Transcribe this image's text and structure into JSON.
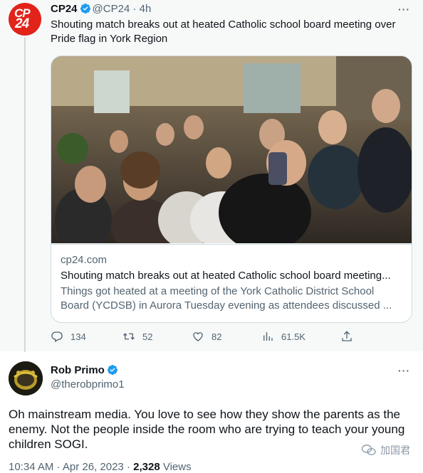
{
  "parent_tweet": {
    "author": {
      "display_name": "CP24",
      "handle": "@CP24",
      "avatar_text_top": "CP",
      "avatar_text_bottom": "24"
    },
    "separator": "·",
    "time_ago": "4h",
    "text": "Shouting match breaks out at heated Catholic school board meeting over Pride flag in York Region",
    "card": {
      "domain": "cp24.com",
      "title": "Shouting match breaks out at heated Catholic school board meeting...",
      "description": "Things got heated at a meeting of the York Catholic District School Board (YCDSB) in Aurora Tuesday evening as attendees discussed ..."
    },
    "actions": {
      "replies": "134",
      "retweets": "52",
      "likes": "82",
      "views": "61.5K"
    }
  },
  "reply_tweet": {
    "author": {
      "display_name": "Rob Primo",
      "handle": "@therobprimo1"
    },
    "text": "Oh mainstream media. You love to see how they show the parents as the enemy. Not the people inside the room who are trying to teach your young children SOGI.",
    "timestamp": "10:34 AM · Apr 26, 2023 ·",
    "view_count": "2,328",
    "views_label": "Views"
  },
  "more_label": "···",
  "watermark": "加国君",
  "colors": {
    "verified": "#1d9bf0",
    "cp24_red": "#e2231a",
    "muted": "#536471",
    "border": "#cfd9de"
  },
  "icons": [
    "verified-badge-icon",
    "more-icon",
    "reply-icon",
    "retweet-icon",
    "like-icon",
    "views-icon",
    "share-icon",
    "wechat-icon"
  ]
}
